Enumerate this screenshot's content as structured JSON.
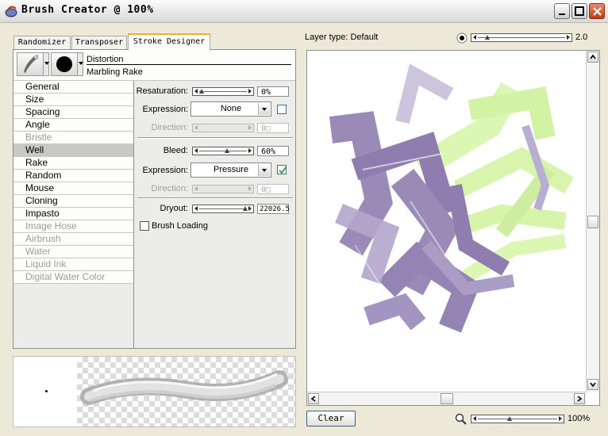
{
  "window": {
    "title": "Brush Creator @ 100%"
  },
  "tabs": [
    {
      "label": "Randomizer"
    },
    {
      "label": "Transposer"
    },
    {
      "label": "Stroke Designer"
    }
  ],
  "brush": {
    "category": "Distortion",
    "variant": "Marbling Rake"
  },
  "categories": [
    {
      "label": "General",
      "enabled": true
    },
    {
      "label": "Size",
      "enabled": true
    },
    {
      "label": "Spacing",
      "enabled": true
    },
    {
      "label": "Angle",
      "enabled": true
    },
    {
      "label": "Bristle",
      "enabled": false
    },
    {
      "label": "Well",
      "enabled": true,
      "selected": true
    },
    {
      "label": "Rake",
      "enabled": true
    },
    {
      "label": "Random",
      "enabled": true
    },
    {
      "label": "Mouse",
      "enabled": true
    },
    {
      "label": "Cloning",
      "enabled": true
    },
    {
      "label": "Impasto",
      "enabled": true
    },
    {
      "label": "Image Hose",
      "enabled": false
    },
    {
      "label": "Airbrush",
      "enabled": false
    },
    {
      "label": "Water",
      "enabled": false
    },
    {
      "label": "Liquid Ink",
      "enabled": false
    },
    {
      "label": "Digital Water Color",
      "enabled": false
    }
  ],
  "well": {
    "resaturation": {
      "label": "Resaturation:",
      "value": "0%",
      "level": 0
    },
    "expression1": {
      "label": "Expression:",
      "value": "None",
      "checked": false
    },
    "direction1": {
      "label": "Direction:",
      "value": "0□"
    },
    "bleed": {
      "label": "Bleed:",
      "value": "60%",
      "level": 0.6
    },
    "expression2": {
      "label": "Expression:",
      "value": "Pressure",
      "checked": true
    },
    "direction2": {
      "label": "Direction:",
      "value": "0□"
    },
    "dryout": {
      "label": "Dryout:",
      "value": "22026.5",
      "level": 1.0
    },
    "brush_loading": {
      "label": "Brush Loading",
      "checked": false
    }
  },
  "canvas": {
    "layer_type": "Layer type: Default",
    "brush_size": "2.0",
    "zoom": "100%",
    "clear_label": "Clear",
    "colors": {
      "purple": "#9a8ab8",
      "green": "#d8f5a8",
      "accent": "#f4a93a"
    }
  }
}
